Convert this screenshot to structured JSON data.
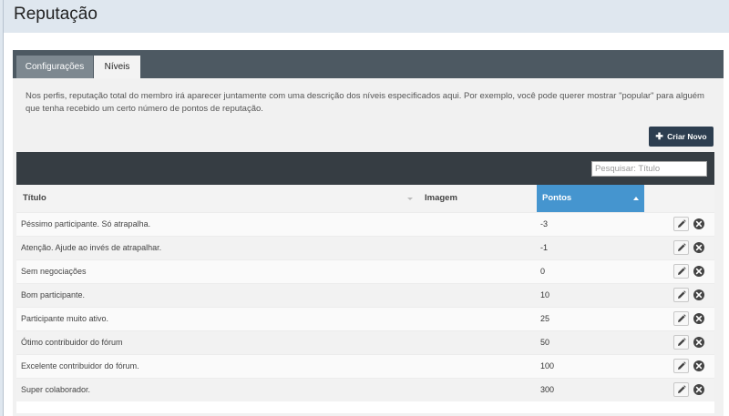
{
  "page": {
    "title": "Reputação"
  },
  "tabs": [
    {
      "label": "Configurações",
      "active": false
    },
    {
      "label": "Níveis",
      "active": true
    }
  ],
  "description": "Nos perfis, reputação total do membro irá aparecer juntamente com uma descrição dos níveis especificados aqui. Por exemplo, você pode querer mostrar \"popular\" para alguém que tenha recebido um certo número de pontos de reputação.",
  "toolbar": {
    "create_label": "Criar Novo",
    "create_icon": "plus-icon"
  },
  "search": {
    "placeholder": "Pesquisar: Título",
    "value": ""
  },
  "table": {
    "columns": [
      "Título",
      "Imagem",
      "Pontos"
    ],
    "sorted_column": "Pontos",
    "sort_direction": "ascending",
    "rows": [
      {
        "title": "Péssimo participante. Só atrapalha.",
        "image": "",
        "points": "-3"
      },
      {
        "title": "Atenção. Ajude ao invés de atrapalhar.",
        "image": "",
        "points": "-1"
      },
      {
        "title": "Sem negociações",
        "image": "",
        "points": "0"
      },
      {
        "title": "Bom participante.",
        "image": "",
        "points": "10"
      },
      {
        "title": "Participante muito ativo.",
        "image": "",
        "points": "25"
      },
      {
        "title": "Ótimo contribuidor do fórum",
        "image": "",
        "points": "50"
      },
      {
        "title": "Excelente contribuidor do fórum.",
        "image": "",
        "points": "100"
      },
      {
        "title": "Super colaborador.",
        "image": "",
        "points": "300"
      }
    ],
    "row_actions": [
      "pencil-icon",
      "close-circle-icon"
    ]
  },
  "colors": {
    "header_bg": "#dfe7ef",
    "tabs_bar": "#4d5962",
    "dark_bar": "#363d43",
    "sorted_header": "#4595cf",
    "create_button": "#2d3e50"
  }
}
